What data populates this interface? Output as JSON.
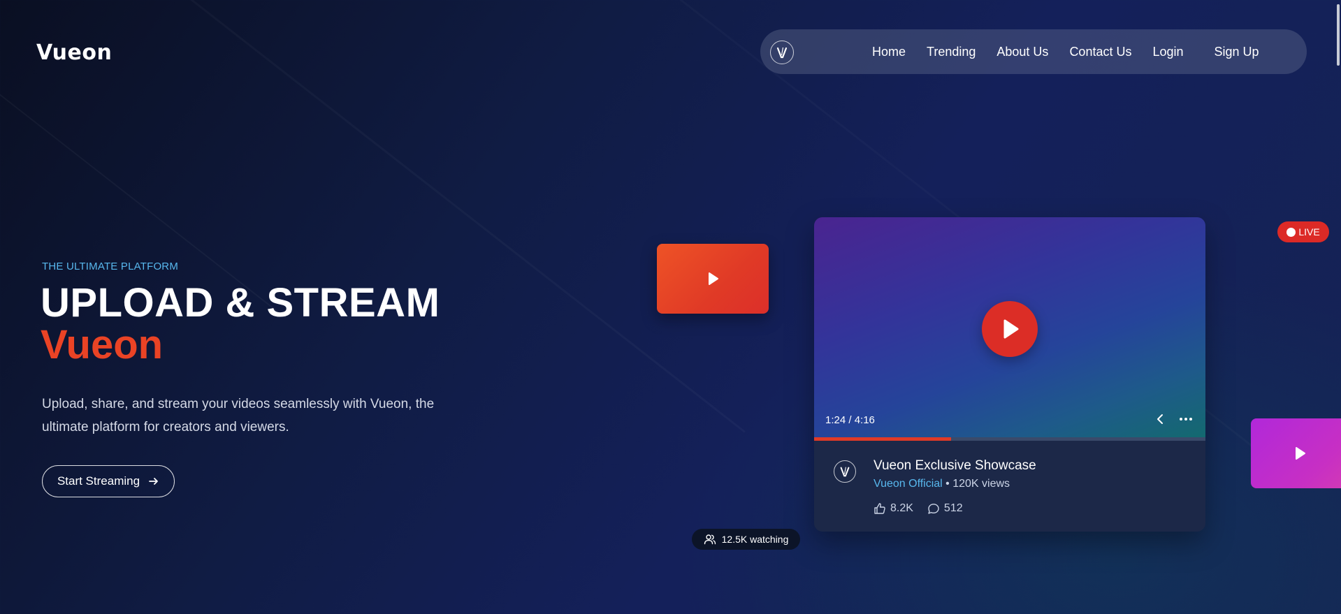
{
  "header": {
    "logo_text": "Vueon",
    "nav": {
      "links": [
        "Home",
        "Trending",
        "About Us",
        "Contact Us",
        "Login",
        "Sign Up"
      ]
    }
  },
  "hero": {
    "eyebrow": "THE ULTIMATE PLATFORM",
    "title_line1": "UPLOAD & STREAM",
    "title_line2": "Vueon",
    "description": "Upload, share, and stream your videos seamlessly with Vueon, the ultimate platform for creators and viewers.",
    "cta_label": "Start Streaming"
  },
  "player": {
    "time": "1:24 / 4:16",
    "progress": 0.35,
    "title": "Vueon Exclusive Showcase",
    "channel": "Vueon Official",
    "separator": " • ",
    "views": "120K views",
    "likes": "8.2K",
    "comments": "512"
  },
  "badges": {
    "live": "LIVE",
    "watching": "12.5K watching"
  },
  "colors": {
    "accent": "#EA4325",
    "play_red": "#DC2D26",
    "link_blue": "#58B8EE",
    "live_red": "#DC2A26"
  },
  "icons": [
    "vueon-emblem-icon",
    "play-icon",
    "arrow-right-icon",
    "chevron-left-icon",
    "more-dots-icon",
    "thumbs-up-icon",
    "comment-icon",
    "users-icon"
  ]
}
